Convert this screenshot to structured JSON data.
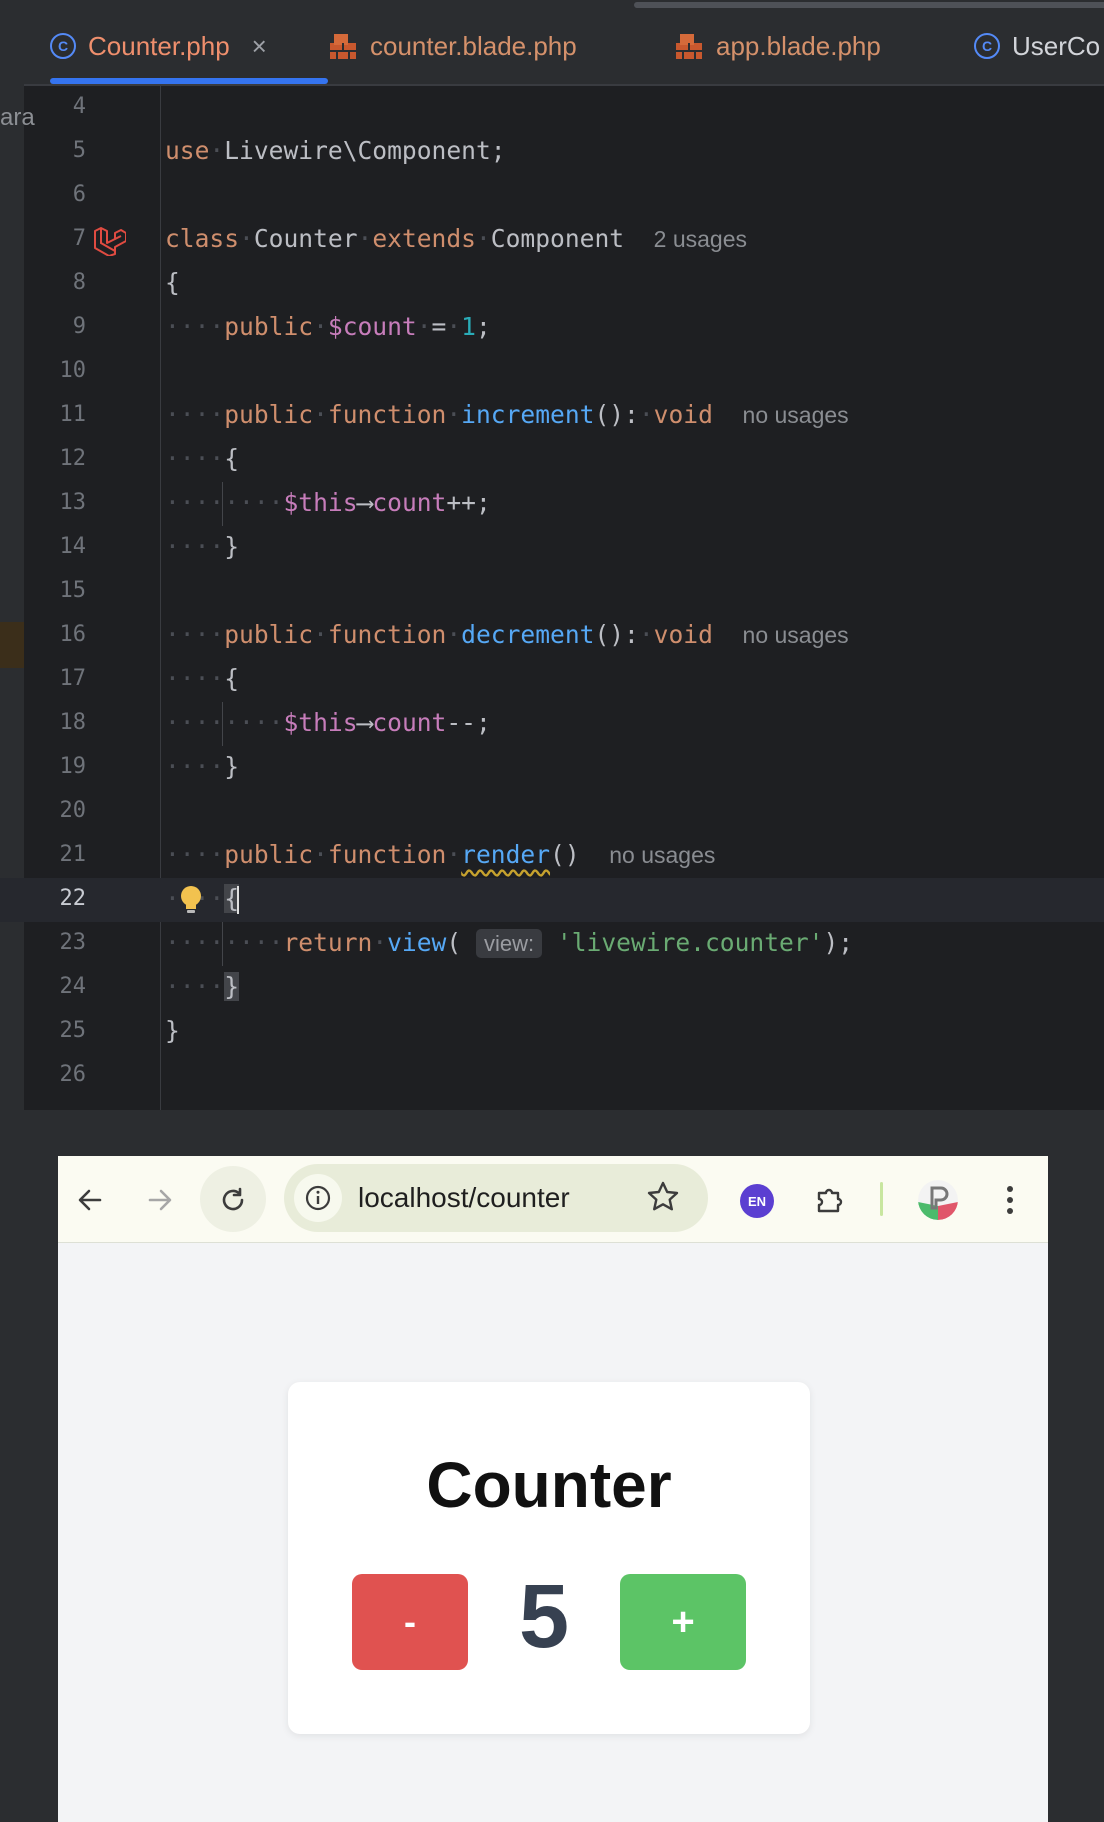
{
  "ide": {
    "tabs": [
      {
        "label": "Counter.php",
        "icon": "class-icon",
        "active": true
      },
      {
        "label": "counter.blade.php",
        "icon": "blade-icon"
      },
      {
        "label": "app.blade.php",
        "icon": "blade-icon"
      },
      {
        "label": "UserCo",
        "icon": "class-icon"
      }
    ],
    "close_glyph": "×",
    "side_cut_text": "ara",
    "current_line": 22,
    "lines": [
      {
        "n": 4,
        "html": ""
      },
      {
        "n": 5,
        "html": "<span class='kw'>use</span><span class='ws'>·</span>Livewire\\Component;"
      },
      {
        "n": 6,
        "html": ""
      },
      {
        "n": 7,
        "html": "<span class='kw'>class</span><span class='ws'>·</span>Counter<span class='ws'>·</span><span class='kw'>extends</span><span class='ws'>·</span>Component  <span class='hint'>2 usages</span>"
      },
      {
        "n": 8,
        "html": "{"
      },
      {
        "n": 9,
        "html": "<span class='ws'>····</span><span class='kw'>public</span><span class='ws'>·</span><span class='var'>$count</span><span class='ws'>·</span>=<span class='ws'>·</span><span class='num'>1</span>;"
      },
      {
        "n": 10,
        "html": ""
      },
      {
        "n": 11,
        "html": "<span class='ws'>····</span><span class='kw'>public</span><span class='ws'>·</span><span class='kw'>function</span><span class='ws'>·</span><span class='fn'>increment</span>():<span class='ws'>·</span><span class='kw'>void</span>  <span class='hint'>no usages</span>"
      },
      {
        "n": 12,
        "html": "<span class='ws'>····</span>{"
      },
      {
        "n": 13,
        "html": "<span class='ws'>········</span><span class='var'>$this</span>⟶<span class='var'>count</span>++;"
      },
      {
        "n": 14,
        "html": "<span class='ws'>····</span>}"
      },
      {
        "n": 15,
        "html": ""
      },
      {
        "n": 16,
        "html": "<span class='ws'>····</span><span class='kw'>public</span><span class='ws'>·</span><span class='kw'>function</span><span class='ws'>·</span><span class='fn'>decrement</span>():<span class='ws'>·</span><span class='kw'>void</span>  <span class='hint'>no usages</span>"
      },
      {
        "n": 17,
        "html": "<span class='ws'>····</span>{"
      },
      {
        "n": 18,
        "html": "<span class='ws'>········</span><span class='var'>$this</span>⟶<span class='var'>count</span>--;"
      },
      {
        "n": 19,
        "html": "<span class='ws'>····</span>}"
      },
      {
        "n": 20,
        "html": ""
      },
      {
        "n": 21,
        "html": "<span class='ws'>····</span><span class='kw'>public</span><span class='ws'>·</span><span class='kw'>function</span><span class='ws'>·</span><span class='fn squiggle'>render</span>()  <span class='hint'>no usages</span>"
      },
      {
        "n": 22,
        "html": "<span class='ws'>····</span><span class='bracehl'>{</span><span class='caret'></span>"
      },
      {
        "n": 23,
        "html": "<span class='ws'>········</span><span class='kw'>return</span><span class='ws'>·</span><span class='fn'>view</span>( <span class='param'>view:</span> <span class='str'>'livewire.counter'</span>);"
      },
      {
        "n": 24,
        "html": "<span class='ws'>····</span><span class='bracehl'>}</span>"
      },
      {
        "n": 25,
        "html": "}"
      },
      {
        "n": 26,
        "html": ""
      }
    ]
  },
  "browser": {
    "url": "localhost/counter",
    "extension_badge": "EN",
    "card": {
      "title": "Counter",
      "decrement_label": "-",
      "increment_label": "+",
      "count": "5"
    }
  }
}
